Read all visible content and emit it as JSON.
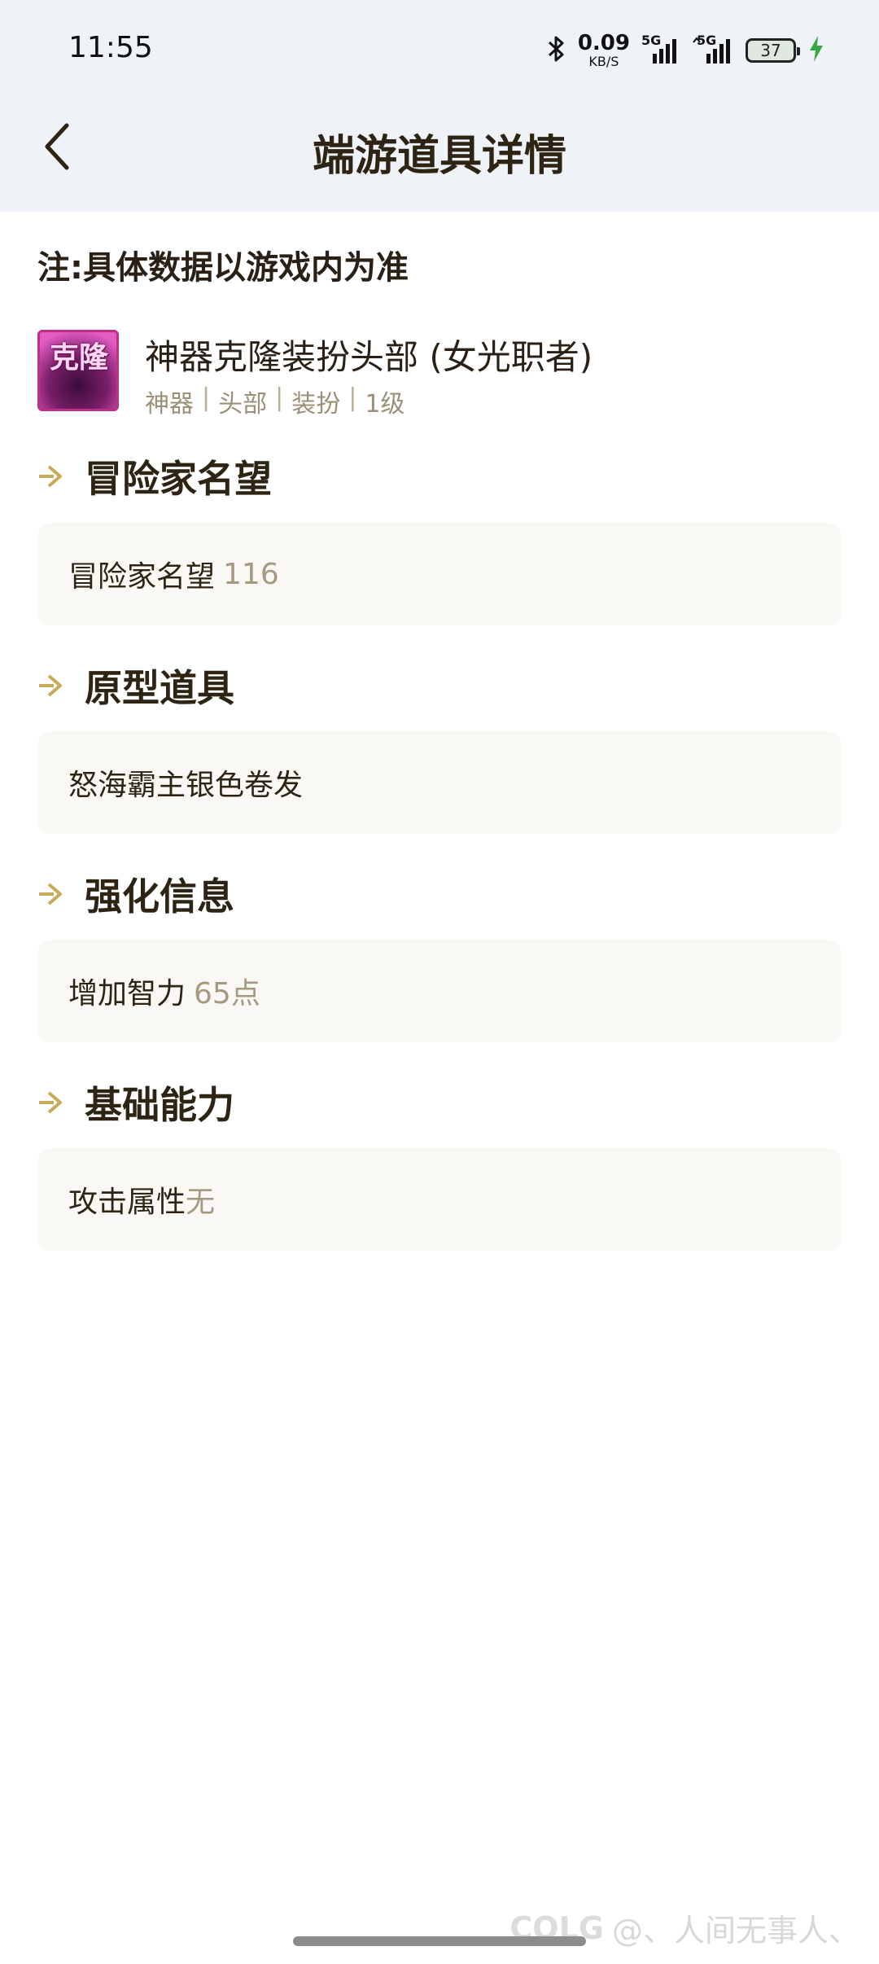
{
  "status_bar": {
    "time": "11:55",
    "net_speed_value": "0.09",
    "net_speed_unit": "KB/S",
    "signal1_label": "5G",
    "signal2_label": "5G",
    "battery_level": "37",
    "icons": [
      "bluetooth-icon",
      "signal-icon",
      "battery-icon",
      "charging-icon"
    ]
  },
  "header": {
    "title": "端游道具详情",
    "back_icon": "chevron-left-icon"
  },
  "note": "注:具体数据以游戏内为准",
  "item": {
    "icon_text": "克隆",
    "name": "神器克隆装扮头部 (女光职者)",
    "tags": [
      "神器",
      "头部",
      "装扮",
      "1级"
    ]
  },
  "sections": [
    {
      "title": "冒险家名望",
      "label": "冒险家名望",
      "value": "116"
    },
    {
      "title": "原型道具",
      "label": "怒海霸主银色卷发",
      "value": ""
    },
    {
      "title": "强化信息",
      "label": "增加智力",
      "value": "65点"
    },
    {
      "title": "基础能力",
      "label": "攻击属性",
      "value": "无"
    }
  ],
  "watermark": {
    "logo": "COLG",
    "text": "@、人间无事人、"
  },
  "colors": {
    "header_bg": "#eff3f8",
    "accent_gold": "#c9a95a",
    "value_muted": "#a59a80",
    "box_bg": "#f9f8f5",
    "icon_border": "#c02f8a"
  }
}
